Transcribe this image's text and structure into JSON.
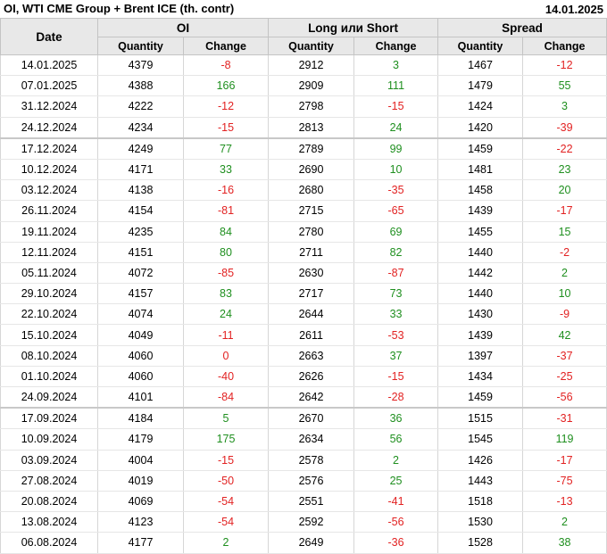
{
  "header": {
    "title": "OI, WTI CME Group + Brent ICE (th. contr)",
    "date": "14.01.2025"
  },
  "columns": {
    "date": "Date",
    "groups": [
      "OI",
      "Long или Short",
      "Spread"
    ],
    "quantity": "Quantity",
    "change": "Change"
  },
  "colors": {
    "positive": "#1f8f1f",
    "negative": "#e22222",
    "header_bg": "#e8e8e8"
  },
  "rows": [
    {
      "date": "14.01.2025",
      "oi_q": "4379",
      "oi_c": "-8",
      "ls_q": "2912",
      "ls_c": "3",
      "sp_q": "1467",
      "sp_c": "-12"
    },
    {
      "date": "07.01.2025",
      "oi_q": "4388",
      "oi_c": "166",
      "ls_q": "2909",
      "ls_c": "111",
      "sp_q": "1479",
      "sp_c": "55"
    },
    {
      "date": "31.12.2024",
      "oi_q": "4222",
      "oi_c": "-12",
      "ls_q": "2798",
      "ls_c": "-15",
      "sp_q": "1424",
      "sp_c": "3"
    },
    {
      "date": "24.12.2024",
      "oi_q": "4234",
      "oi_c": "-15",
      "ls_q": "2813",
      "ls_c": "24",
      "sp_q": "1420",
      "sp_c": "-39"
    },
    {
      "date": "17.12.2024",
      "oi_q": "4249",
      "oi_c": "77",
      "ls_q": "2789",
      "ls_c": "99",
      "sp_q": "1459",
      "sp_c": "-22"
    },
    {
      "date": "10.12.2024",
      "oi_q": "4171",
      "oi_c": "33",
      "ls_q": "2690",
      "ls_c": "10",
      "sp_q": "1481",
      "sp_c": "23"
    },
    {
      "date": "03.12.2024",
      "oi_q": "4138",
      "oi_c": "-16",
      "ls_q": "2680",
      "ls_c": "-35",
      "sp_q": "1458",
      "sp_c": "20"
    },
    {
      "date": "26.11.2024",
      "oi_q": "4154",
      "oi_c": "-81",
      "ls_q": "2715",
      "ls_c": "-65",
      "sp_q": "1439",
      "sp_c": "-17"
    },
    {
      "date": "19.11.2024",
      "oi_q": "4235",
      "oi_c": "84",
      "ls_q": "2780",
      "ls_c": "69",
      "sp_q": "1455",
      "sp_c": "15"
    },
    {
      "date": "12.11.2024",
      "oi_q": "4151",
      "oi_c": "80",
      "ls_q": "2711",
      "ls_c": "82",
      "sp_q": "1440",
      "sp_c": "-2"
    },
    {
      "date": "05.11.2024",
      "oi_q": "4072",
      "oi_c": "-85",
      "ls_q": "2630",
      "ls_c": "-87",
      "sp_q": "1442",
      "sp_c": "2"
    },
    {
      "date": "29.10.2024",
      "oi_q": "4157",
      "oi_c": "83",
      "ls_q": "2717",
      "ls_c": "73",
      "sp_q": "1440",
      "sp_c": "10"
    },
    {
      "date": "22.10.2024",
      "oi_q": "4074",
      "oi_c": "24",
      "ls_q": "2644",
      "ls_c": "33",
      "sp_q": "1430",
      "sp_c": "-9"
    },
    {
      "date": "15.10.2024",
      "oi_q": "4049",
      "oi_c": "-11",
      "ls_q": "2611",
      "ls_c": "-53",
      "sp_q": "1439",
      "sp_c": "42"
    },
    {
      "date": "08.10.2024",
      "oi_q": "4060",
      "oi_c": "0",
      "ls_q": "2663",
      "ls_c": "37",
      "sp_q": "1397",
      "sp_c": "-37"
    },
    {
      "date": "01.10.2024",
      "oi_q": "4060",
      "oi_c": "-40",
      "ls_q": "2626",
      "ls_c": "-15",
      "sp_q": "1434",
      "sp_c": "-25"
    },
    {
      "date": "24.09.2024",
      "oi_q": "4101",
      "oi_c": "-84",
      "ls_q": "2642",
      "ls_c": "-28",
      "sp_q": "1459",
      "sp_c": "-56"
    },
    {
      "date": "17.09.2024",
      "oi_q": "4184",
      "oi_c": "5",
      "ls_q": "2670",
      "ls_c": "36",
      "sp_q": "1515",
      "sp_c": "-31"
    },
    {
      "date": "10.09.2024",
      "oi_q": "4179",
      "oi_c": "175",
      "ls_q": "2634",
      "ls_c": "56",
      "sp_q": "1545",
      "sp_c": "119"
    },
    {
      "date": "03.09.2024",
      "oi_q": "4004",
      "oi_c": "-15",
      "ls_q": "2578",
      "ls_c": "2",
      "sp_q": "1426",
      "sp_c": "-17"
    },
    {
      "date": "27.08.2024",
      "oi_q": "4019",
      "oi_c": "-50",
      "ls_q": "2576",
      "ls_c": "25",
      "sp_q": "1443",
      "sp_c": "-75"
    },
    {
      "date": "20.08.2024",
      "oi_q": "4069",
      "oi_c": "-54",
      "ls_q": "2551",
      "ls_c": "-41",
      "sp_q": "1518",
      "sp_c": "-13"
    },
    {
      "date": "13.08.2024",
      "oi_q": "4123",
      "oi_c": "-54",
      "ls_q": "2592",
      "ls_c": "-56",
      "sp_q": "1530",
      "sp_c": "2"
    },
    {
      "date": "06.08.2024",
      "oi_q": "4177",
      "oi_c": "2",
      "ls_q": "2649",
      "ls_c": "-36",
      "sp_q": "1528",
      "sp_c": "38"
    }
  ]
}
